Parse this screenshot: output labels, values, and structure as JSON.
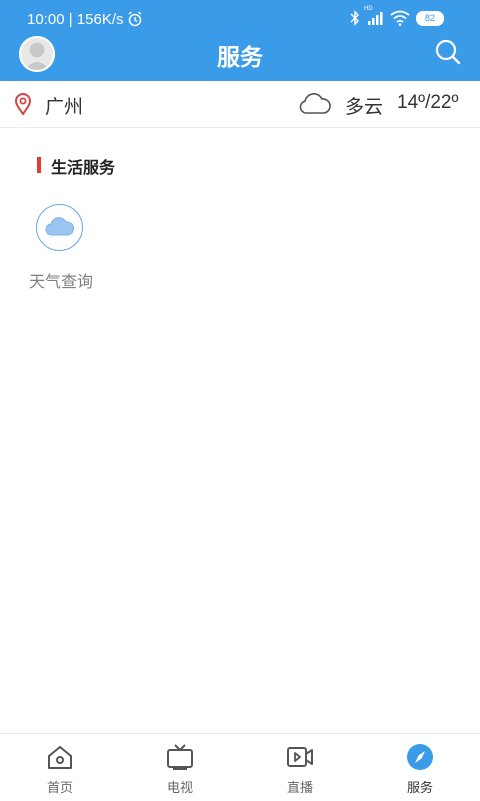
{
  "status_bar": {
    "time": "10:00",
    "speed": "156K/s",
    "battery": "82",
    "signal_label": "HD"
  },
  "header": {
    "title": "服务"
  },
  "location": {
    "city": "广州",
    "weather_desc": "多云",
    "temperature": "14º/22º"
  },
  "section": {
    "title": "生活服务"
  },
  "services": [
    {
      "label": "天气查询",
      "icon": "cloud-icon"
    }
  ],
  "tabs": [
    {
      "label": "首页",
      "icon": "home-icon"
    },
    {
      "label": "电视",
      "icon": "tv-icon"
    },
    {
      "label": "直播",
      "icon": "video-icon"
    },
    {
      "label": "服务",
      "icon": "compass-icon",
      "active": true
    }
  ],
  "colors": {
    "primary": "#3a9be8",
    "accent_red": "#e53935",
    "location_red": "#d94343",
    "service_icon": "#6aa5e4"
  }
}
